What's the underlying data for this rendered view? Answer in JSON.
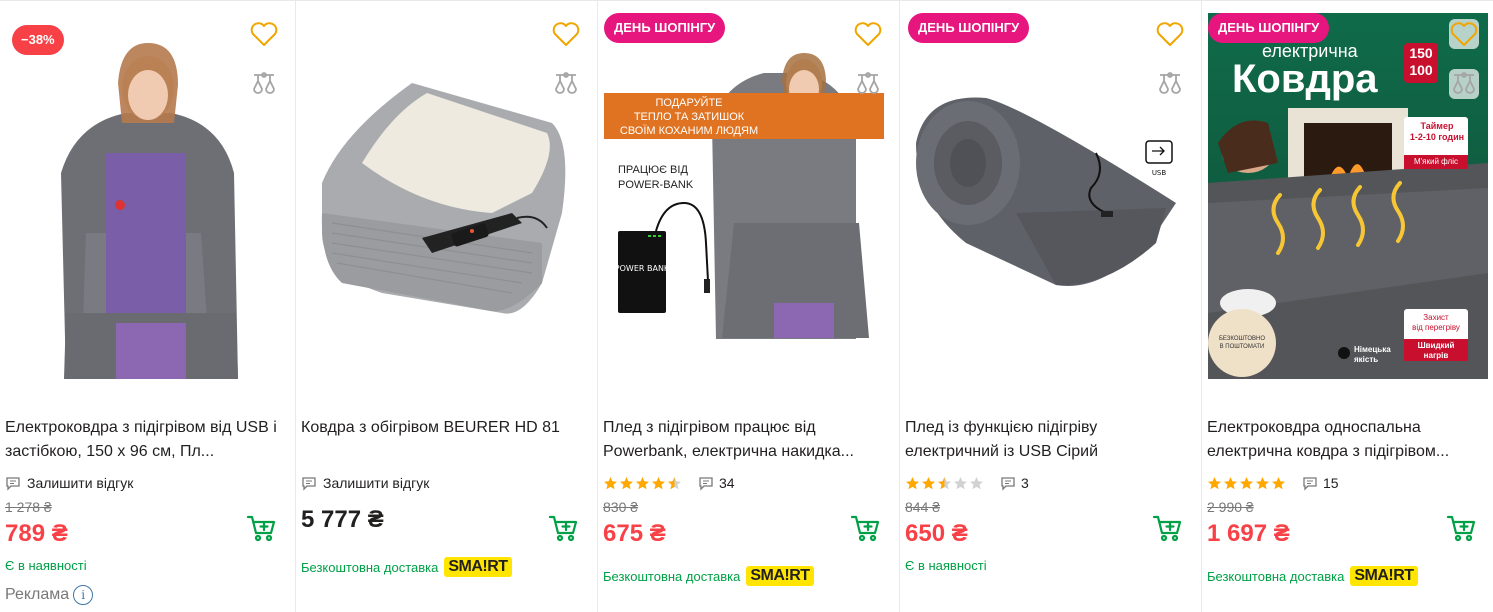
{
  "products": [
    {
      "badge": "−38%",
      "title": "Електроковдра з підігрівом від USB і застібкою, 150 x 96 см, Пл...",
      "review_label": "Залишити відгук",
      "old_price": "1 278 ₴",
      "price": "789 ₴",
      "availability": "Є в наявності",
      "ad_label": "Реклама",
      "ad_info": "i"
    },
    {
      "title": "Ковдра з обігрівом BEURER HD 81",
      "review_label": "Залишити відгук",
      "price": "5 777 ₴",
      "delivery": "Безкоштовна доставка",
      "smart": "SMA!RT"
    },
    {
      "badge": "ДЕНЬ ШОПІНГУ",
      "title": "Плед з підігрівом працює від Powerbank, електрична накидка...",
      "rating": 4.5,
      "reviews_count": "34",
      "old_price": "830 ₴",
      "price": "675 ₴",
      "delivery": "Безкоштовна доставка",
      "smart": "SMA!RT",
      "promo_strip": "ПОДАРУЙТЕ\nТЕПЛО ТА ЗАТИШОК\nСВОЇМ КОХАНИМ ЛЮДЯМ",
      "promo_power": "ПРАЦЮЄ ВІД\nPOWER-BANK",
      "promo_bank": "POWER BANK"
    },
    {
      "badge": "ДЕНЬ ШОПІНГУ",
      "title": "Плед із функцією підігріву електричний із USB Сірий",
      "rating": 2.5,
      "reviews_count": "3",
      "old_price": "844 ₴",
      "price": "650 ₴",
      "availability": "Є в наявності",
      "usb_label": "USB"
    },
    {
      "badge": "ДЕНЬ ШОПІНГУ",
      "title": "Електроковдра односпальна електрична ковдра з підігрівом...",
      "rating": 5,
      "reviews_count": "15",
      "old_price": "2 990 ₴",
      "price": "1 697 ₴",
      "delivery": "Безкоштовна доставка",
      "smart": "SMA!RT",
      "promo_small": "електрична",
      "promo_big": "Ковдра",
      "promo_size": "150\n100",
      "promo_timer": "Таймер\n1-2-10 годин",
      "promo_fleece": "М'який фліс",
      "promo_protect": "Захист\nвід перегріву",
      "promo_fast": "Швидкий\nнагрів",
      "promo_quality": "Німецька\nякість",
      "promo_free": "БЕЗКОШТОВНО\nВ ПОШТОМАТИ"
    }
  ],
  "colors": {
    "accent_red": "#f84147",
    "accent_green": "#00a046",
    "star_gold": "#ffa900",
    "shop_day_pink": "#e7167f",
    "heart": "#f0a500"
  }
}
